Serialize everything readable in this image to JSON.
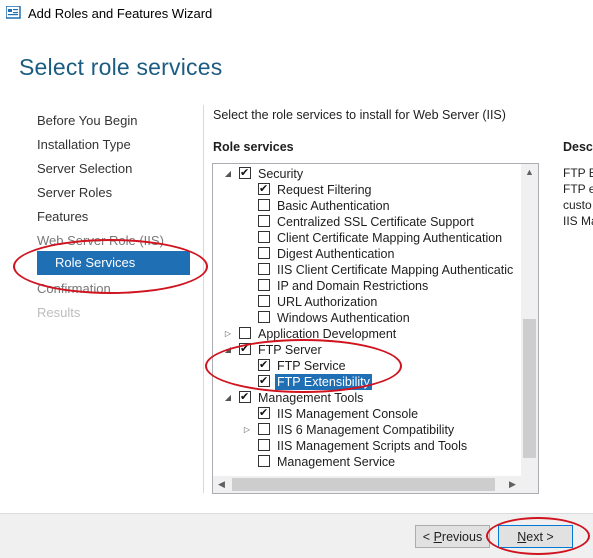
{
  "window": {
    "title": "Add Roles and Features Wizard"
  },
  "page": {
    "heading": "Select role services",
    "instruction": "Select the role services to install for Web Server (IIS)",
    "role_services_label": "Role services",
    "description_label": "Descr",
    "description_lines": [
      "FTP Ex",
      "FTP ex",
      "custo",
      "IIS Ma"
    ]
  },
  "nav": {
    "items": [
      {
        "label": "Before You Begin"
      },
      {
        "label": "Installation Type"
      },
      {
        "label": "Server Selection"
      },
      {
        "label": "Server Roles"
      },
      {
        "label": "Features"
      },
      {
        "label": "Web Server Role (IIS)"
      },
      {
        "label": "Role Services"
      },
      {
        "label": "Confirmation"
      },
      {
        "label": "Results"
      }
    ],
    "active_index": 6
  },
  "tree": {
    "rows": [
      {
        "label": "Security",
        "checked": true,
        "expander": "expanded"
      },
      {
        "label": "Request Filtering",
        "checked": true
      },
      {
        "label": "Basic Authentication",
        "checked": false
      },
      {
        "label": "Centralized SSL Certificate Support",
        "checked": false
      },
      {
        "label": "Client Certificate Mapping Authentication",
        "checked": false
      },
      {
        "label": "Digest Authentication",
        "checked": false
      },
      {
        "label": "IIS Client Certificate Mapping Authenticatic",
        "checked": false
      },
      {
        "label": "IP and Domain Restrictions",
        "checked": false
      },
      {
        "label": "URL Authorization",
        "checked": false
      },
      {
        "label": "Windows Authentication",
        "checked": false
      },
      {
        "label": "Application Development",
        "checked": false,
        "expander": "collapsed"
      },
      {
        "label": "FTP Server",
        "checked": true,
        "expander": "expanded"
      },
      {
        "label": "FTP Service",
        "checked": true
      },
      {
        "label": "FTP Extensibility",
        "checked": true,
        "selected": true
      },
      {
        "label": "Management Tools",
        "checked": true,
        "expander": "expanded"
      },
      {
        "label": "IIS Management Console",
        "checked": true
      },
      {
        "label": "IIS 6 Management Compatibility",
        "checked": false,
        "expander": "collapsed"
      },
      {
        "label": "IIS Management Scripts and Tools",
        "checked": false
      },
      {
        "label": "Management Service",
        "checked": false
      }
    ]
  },
  "buttons": {
    "previous_mnemonic": "P",
    "previous_rest": "revious",
    "previous_prefix": "< ",
    "next_mnemonic": "N",
    "next_rest": "ext >"
  },
  "colors": {
    "accent": "#1f6fb4",
    "heading": "#1b5c82",
    "annotation": "#d0131e"
  },
  "icons": [
    "wizard-app-icon",
    "expand-triangle-icon",
    "collapse-triangle-icon",
    "scroll-up-icon",
    "scroll-down-icon",
    "scroll-left-icon",
    "scroll-right-icon",
    "checkmark-icon"
  ]
}
